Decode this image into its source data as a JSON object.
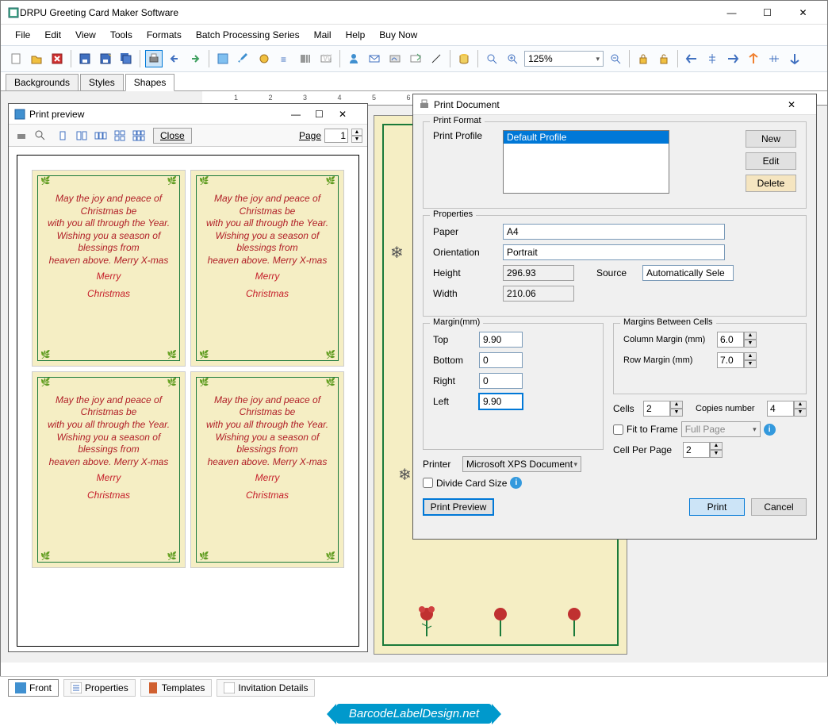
{
  "app": {
    "title": "DRPU Greeting Card Maker Software"
  },
  "menu": {
    "file": "File",
    "edit": "Edit",
    "view": "View",
    "tools": "Tools",
    "formats": "Formats",
    "batch": "Batch Processing Series",
    "mail": "Mail",
    "help": "Help",
    "buy": "Buy Now"
  },
  "toolbar": {
    "zoom": "125%"
  },
  "left_tabs": {
    "backgrounds": "Backgrounds",
    "styles": "Styles",
    "shapes": "Shapes"
  },
  "ruler_marks": "1      2      3      4      5      6      7      8      9      10     11",
  "card": {
    "line1": "May the joy and peace of Christmas be",
    "line2": "with you all through the Year.",
    "line3": "Wishing you a season of blessings from",
    "line4": "heaven above. Merry X-mas",
    "merry1": "Merry",
    "merry2": "Christmas"
  },
  "bottom_tabs": {
    "front": "Front",
    "properties": "Properties",
    "templates": "Templates",
    "invitation": "Invitation Details"
  },
  "footer": {
    "badge": "BarcodeLabelDesign.net"
  },
  "preview": {
    "title": "Print preview",
    "close": "Close",
    "page_label": "Page",
    "page_value": "1"
  },
  "print_dialog": {
    "title": "Print Document",
    "format_legend": "Print Format",
    "profile_label": "Print Profile",
    "profile_value": "Default Profile",
    "new_btn": "New",
    "edit_btn": "Edit",
    "delete_btn": "Delete",
    "props_legend": "Properties",
    "paper_label": "Paper",
    "paper_value": "A4",
    "orientation_label": "Orientation",
    "orientation_value": "Portrait",
    "height_label": "Height",
    "height_value": "296.93",
    "width_label": "Width",
    "width_value": "210.06",
    "source_label": "Source",
    "source_value": "Automatically Sele",
    "margin_legend": "Margin(mm)",
    "top_label": "Top",
    "top_value": "9.90",
    "bottom_label": "Bottom",
    "bottom_value": "0",
    "right_label": "Right",
    "right_value": "0",
    "left_label": "Left",
    "left_value": "9.90",
    "printer_label": "Printer",
    "printer_value": "Microsoft XPS Document",
    "divide_label": "Divide Card Size",
    "between_legend": "Margins Between Cells",
    "col_margin_label": "Column Margin (mm)",
    "col_margin_value": "6.0",
    "row_margin_label": "Row Margin (mm)",
    "row_margin_value": "7.0",
    "cells_label": "Cells",
    "cells_value": "2",
    "copies_label": "Copies number",
    "copies_value": "4",
    "fit_label": "Fit to Frame",
    "fit_value": "Full Page",
    "cellper_label": "Cell Per Page",
    "cellper_value": "2",
    "preview_btn": "Print Preview",
    "print_btn": "Print",
    "cancel_btn": "Cancel"
  }
}
